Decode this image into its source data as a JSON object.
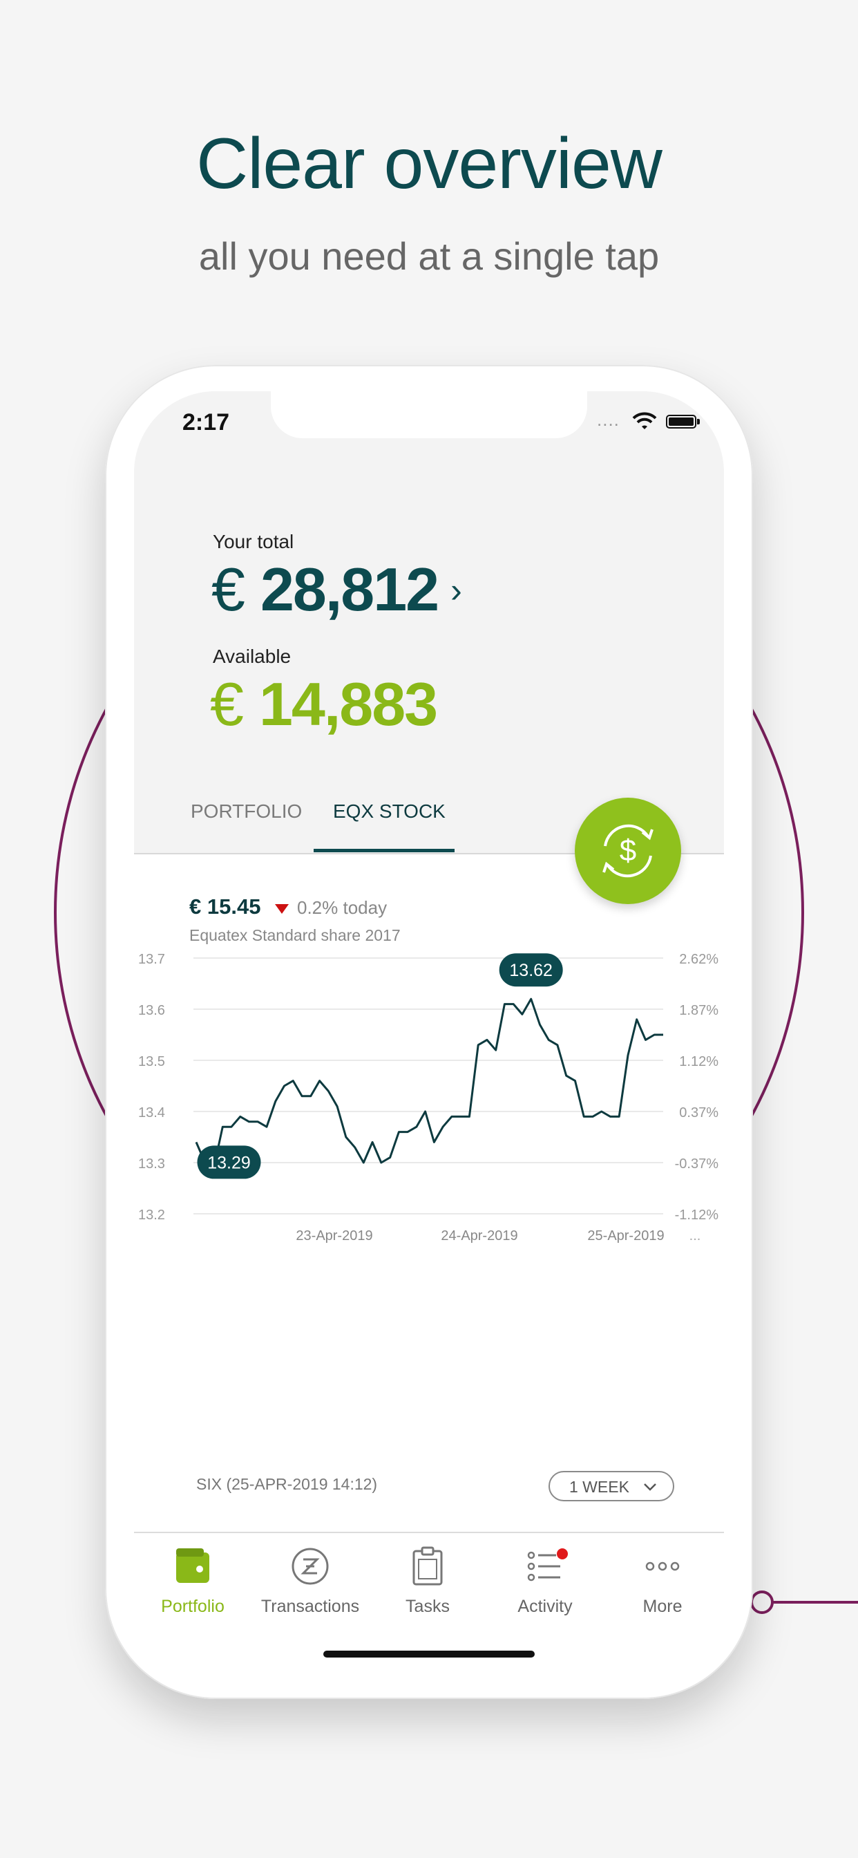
{
  "promo": {
    "headline": "Clear overview",
    "subline": "all you need at a single tap"
  },
  "status_bar": {
    "time": "2:17",
    "signal": "....",
    "icons": [
      "wifi-icon",
      "battery-icon"
    ]
  },
  "summary": {
    "total_label": "Your total",
    "currency": "€",
    "total_value": "28,812",
    "total_chevron": "›",
    "available_label": "Available",
    "available_value": "14,883"
  },
  "tabs": [
    {
      "label": "PORTFOLIO",
      "selected": false
    },
    {
      "label": "EQX STOCK",
      "selected": true
    }
  ],
  "fab": {
    "icon": "currency-exchange-icon"
  },
  "stock": {
    "price": "€ 15.45",
    "change": "0.2% today",
    "name": "Equatex Standard share 2017",
    "exchange_info": "SIX (25-APR-2019 14:12)",
    "period_label": "1 WEEK",
    "ellipsis": "..."
  },
  "chart_data": {
    "type": "line",
    "y_left_ticks": [
      "13.7",
      "13.6",
      "13.5",
      "13.4",
      "13.3",
      "13.2"
    ],
    "y_right_ticks": [
      "2.62%",
      "1.87%",
      "1.12%",
      "0.37%",
      "-0.37%",
      "-1.12%"
    ],
    "x_ticks": [
      "23-Apr-2019",
      "24-Apr-2019",
      "25-Apr-2019"
    ],
    "ylim": [
      13.2,
      13.7
    ],
    "min_label": "13.29",
    "max_label": "13.62",
    "series": [
      {
        "values": [
          13.34,
          13.3,
          13.29,
          13.37,
          13.37,
          13.39,
          13.38,
          13.38,
          13.37,
          13.42,
          13.45,
          13.46,
          13.43,
          13.43,
          13.46,
          13.44,
          13.41,
          13.35,
          13.33,
          13.3,
          13.34,
          13.3,
          13.31,
          13.36,
          13.36,
          13.37,
          13.4,
          13.34,
          13.37,
          13.39,
          13.39,
          13.39,
          13.53,
          13.54,
          13.52,
          13.61,
          13.61,
          13.59,
          13.62,
          13.57,
          13.54,
          13.53,
          13.47,
          13.46,
          13.39,
          13.39,
          13.4,
          13.39,
          13.39,
          13.51,
          13.58,
          13.54,
          13.55,
          13.55
        ],
        "color": "#0d3a3f"
      }
    ],
    "grid": true
  },
  "bottom_nav": [
    {
      "label": "Portfolio",
      "icon": "wallet-icon",
      "active": true
    },
    {
      "label": "Transactions",
      "icon": "transactions-icon",
      "active": false
    },
    {
      "label": "Tasks",
      "icon": "clipboard-icon",
      "active": false
    },
    {
      "label": "Activity",
      "icon": "activity-list-icon",
      "active": false,
      "badge": true
    },
    {
      "label": "More",
      "icon": "more-dots-icon",
      "active": false
    }
  ],
  "colors": {
    "brand_dark": "#0d4a4f",
    "accent_green": "#8ab818",
    "decor_purple": "#7a1f5c",
    "negative_red": "#cc1111"
  }
}
